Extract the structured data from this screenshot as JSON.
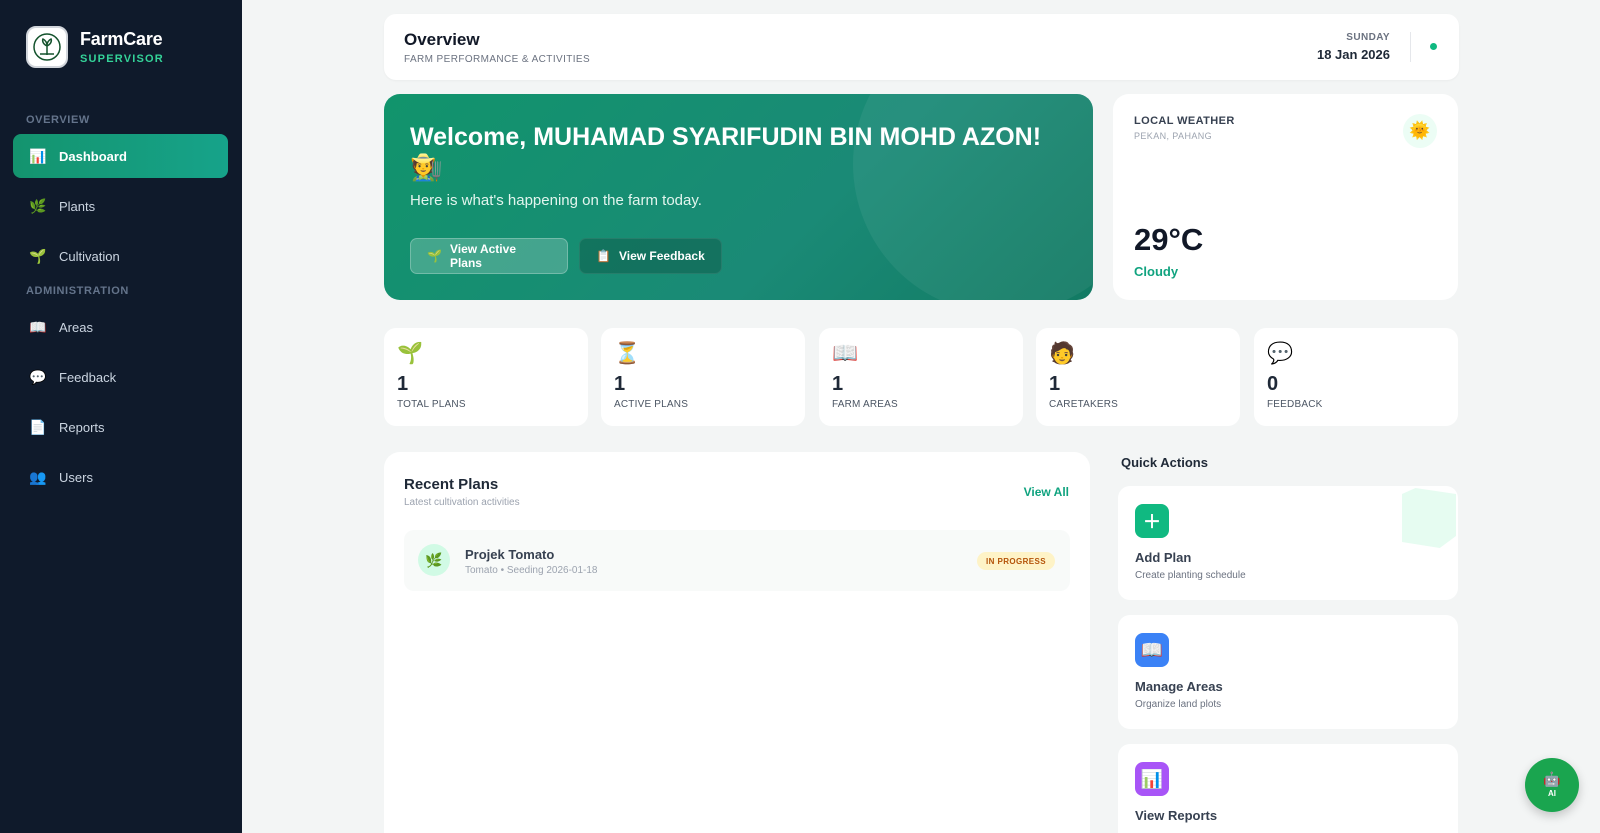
{
  "sidebar": {
    "brand_name": "FarmCare",
    "brand_role": "SUPERVISOR",
    "section_overview": "OVERVIEW",
    "section_admin": "ADMINISTRATION",
    "items": [
      {
        "label": "Dashboard",
        "icon": "bar-chart-icon",
        "active": true
      },
      {
        "label": "Plants",
        "icon": "herb-icon"
      },
      {
        "label": "Cultivation",
        "icon": "seedling-icon"
      },
      {
        "label": "Areas",
        "icon": "map-icon"
      },
      {
        "label": "Feedback",
        "icon": "speech-bubble-icon"
      },
      {
        "label": "Reports",
        "icon": "document-icon"
      },
      {
        "label": "Users",
        "icon": "users-icon"
      }
    ]
  },
  "header": {
    "title": "Overview",
    "subtitle": "FARM PERFORMANCE & ACTIVITIES",
    "day": "SUNDAY",
    "date": "18 Jan 2026"
  },
  "welcome": {
    "title": "Welcome, MUHAMAD SYARIFUDIN BIN MOHD AZON!",
    "emoji": "🧑‍🌾",
    "subtitle": "Here is what's happening on the farm today.",
    "btn_active_plans": "View Active Plans",
    "btn_feedback": "View Feedback"
  },
  "weather": {
    "title": "LOCAL WEATHER",
    "location": "PEKAN, PAHANG",
    "temp": "29°C",
    "condition": "Cloudy",
    "icon": "sun-icon"
  },
  "stats": [
    {
      "value": "1",
      "label": "TOTAL PLANS",
      "icon": "🌱"
    },
    {
      "value": "1",
      "label": "ACTIVE PLANS",
      "icon": "⏳"
    },
    {
      "value": "1",
      "label": "FARM AREAS",
      "icon": "📖"
    },
    {
      "value": "1",
      "label": "CARETAKERS",
      "icon": "🧑"
    },
    {
      "value": "0",
      "label": "FEEDBACK",
      "icon": "💬"
    }
  ],
  "recent": {
    "title": "Recent Plans",
    "subtitle": "Latest cultivation activities",
    "view_all": "View All",
    "plans": [
      {
        "name": "Projek Tomato",
        "meta": "Tomato • Seeding 2026-01-18",
        "status": "IN PROGRESS"
      }
    ]
  },
  "quick_actions": {
    "title": "Quick Actions",
    "items": [
      {
        "name": "Add Plan",
        "desc": "Create planting schedule",
        "icon": "plus-icon",
        "color": "#10b981"
      },
      {
        "name": "Manage Areas",
        "desc": "Organize land plots",
        "icon": "map-icon",
        "color": "#3b82f6"
      },
      {
        "name": "View Reports",
        "desc": "",
        "icon": "bar-chart-icon",
        "color": "#a855f7"
      }
    ]
  },
  "ai_fab": {
    "label": "AI"
  },
  "colors": {
    "sidebar_bg": "#0f1a2b",
    "accent": "#10a37f",
    "badge_bg": "#fef3c7",
    "badge_text": "#b45309"
  }
}
